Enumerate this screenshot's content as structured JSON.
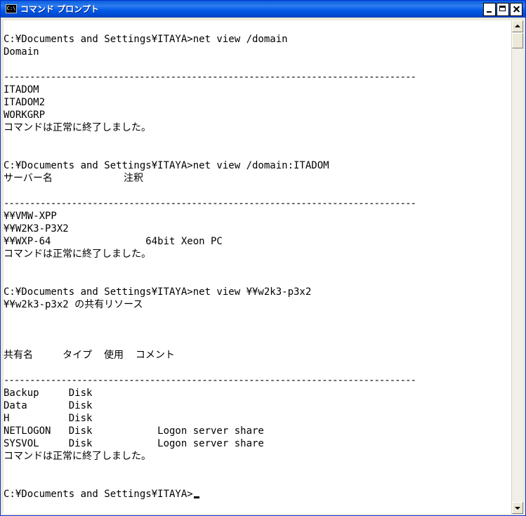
{
  "window": {
    "title": "コマンド プロンプト",
    "icon_label": "C:\\",
    "buttons": [
      "minimize",
      "maximize",
      "close"
    ]
  },
  "console": {
    "lines": [
      "",
      "C:¥Documents and Settings¥ITAYA>net view /domain",
      "Domain",
      "",
      "-------------------------------------------------------------------------------",
      "ITADOM",
      "ITADOM2",
      "WORKGRP",
      "コマンドは正常に終了しました。",
      "",
      "",
      "C:¥Documents and Settings¥ITAYA>net view /domain:ITADOM",
      "サーバー名            注釈",
      "",
      "-------------------------------------------------------------------------------",
      "¥¥VMW-XPP",
      "¥¥W2K3-P3X2",
      "¥¥WXP-64                64bit Xeon PC",
      "コマンドは正常に終了しました。",
      "",
      "",
      "C:¥Documents and Settings¥ITAYA>net view ¥¥w2k3-p3x2",
      "¥¥w2k3-p3x2 の共有リソース",
      "",
      "",
      "",
      "共有名     タイプ  使用  コメント",
      "",
      "-------------------------------------------------------------------------------",
      "Backup     Disk",
      "Data       Disk",
      "H          Disk",
      "NETLOGON   Disk           Logon server share",
      "SYSVOL     Disk           Logon server share",
      "コマンドは正常に終了しました。",
      "",
      "",
      "C:¥Documents and Settings¥ITAYA>"
    ]
  },
  "colors": {
    "titlebar": "#0058e6",
    "console_bg": "#ffffff",
    "console_fg": "#000000"
  }
}
